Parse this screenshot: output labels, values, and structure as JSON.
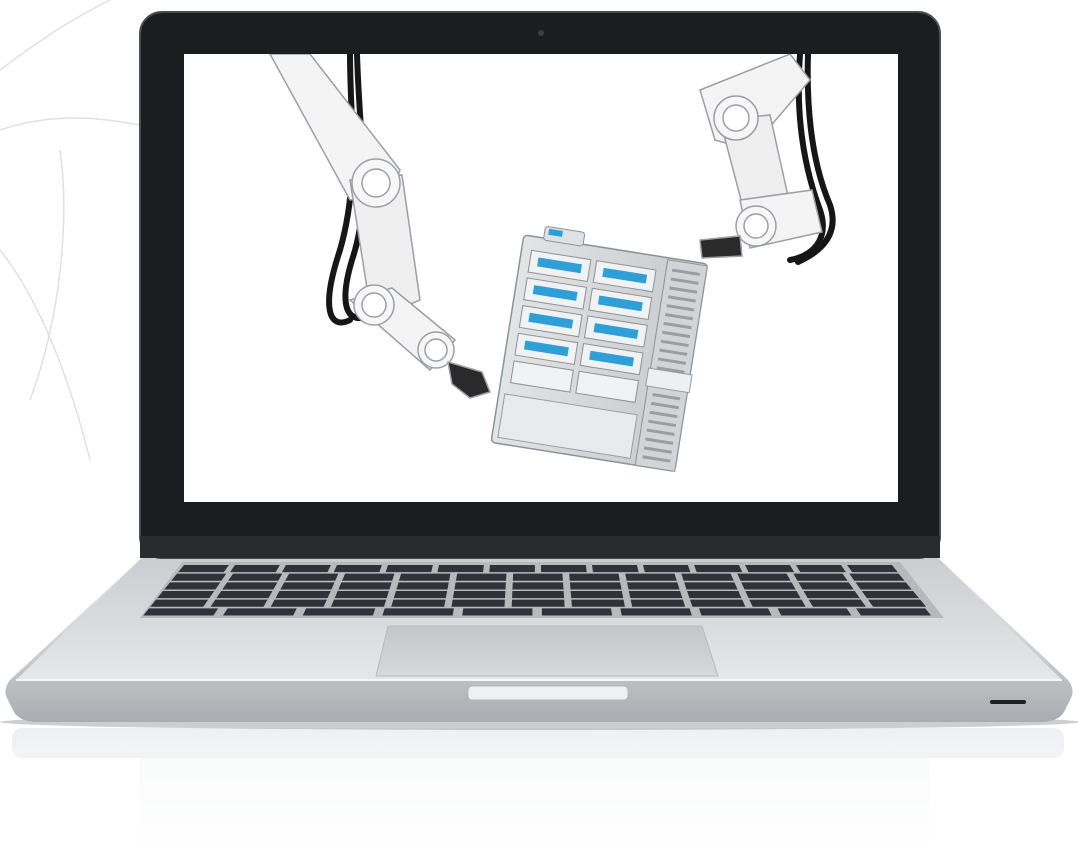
{
  "scene": {
    "subject": "laptop-with-robotic-arms-on-screen",
    "colors": {
      "background": "#ffffff",
      "bezel": "#1c1d1f",
      "screen": "#ffffff",
      "aluminum": "#d9dbde",
      "keys": "#2f3236",
      "rack_accent": "#2f9fd8",
      "cable": "#1a1a1a",
      "arm": "#f4f4f4"
    },
    "icons": [
      "camera-icon",
      "robot-arm-left-icon",
      "robot-arm-right-icon",
      "server-rack-icon",
      "status-light-icon"
    ]
  }
}
